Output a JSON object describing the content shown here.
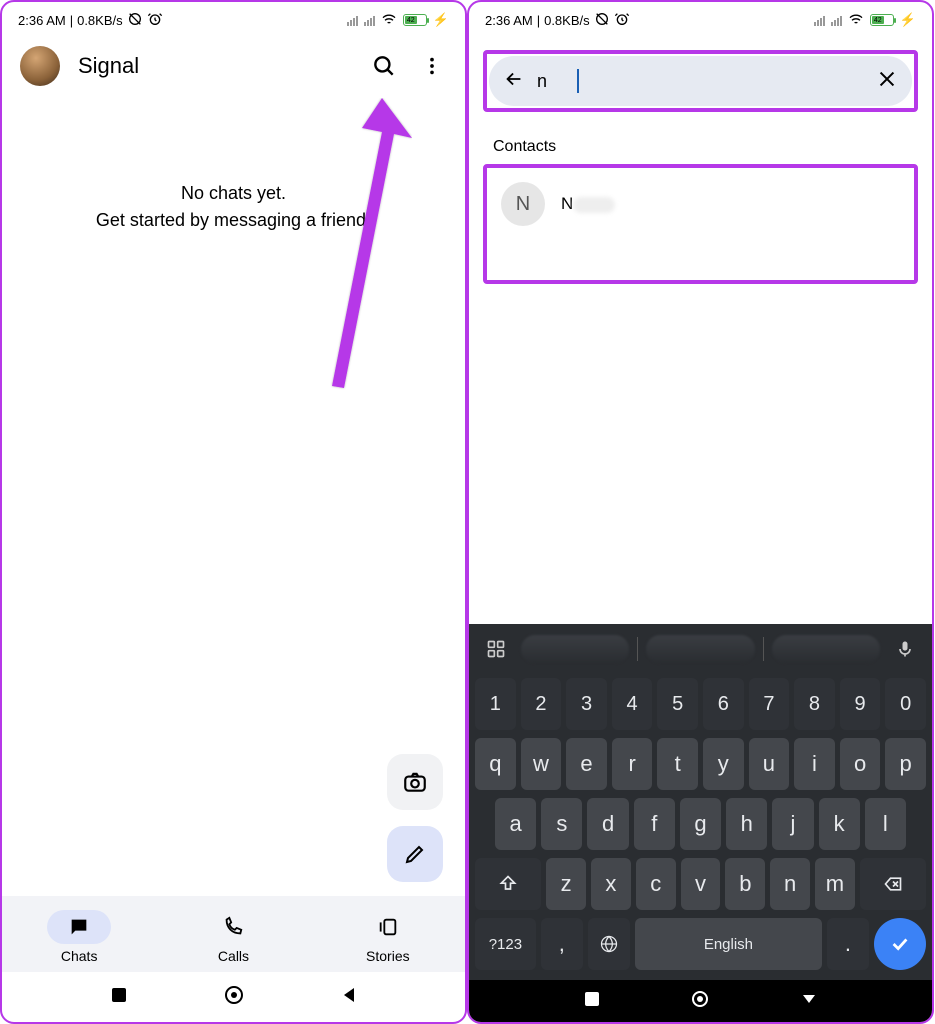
{
  "status": {
    "time": "2:36 AM",
    "speed": "0.8KB/s",
    "battery_text": "42"
  },
  "left": {
    "app_title": "Signal",
    "empty_line1": "No chats yet.",
    "empty_line2": "Get started by messaging a friend.",
    "nav": {
      "chats": "Chats",
      "calls": "Calls",
      "stories": "Stories"
    }
  },
  "right": {
    "search_value": "n",
    "section_label": "Contacts",
    "contact": {
      "initial": "N",
      "name": "N"
    },
    "keyboard": {
      "row_num": [
        "1",
        "2",
        "3",
        "4",
        "5",
        "6",
        "7",
        "8",
        "9",
        "0"
      ],
      "row1": [
        "q",
        "w",
        "e",
        "r",
        "t",
        "y",
        "u",
        "i",
        "o",
        "p"
      ],
      "row2": [
        "a",
        "s",
        "d",
        "f",
        "g",
        "h",
        "j",
        "k",
        "l"
      ],
      "row3": [
        "z",
        "x",
        "c",
        "v",
        "b",
        "n",
        "m"
      ],
      "symbols": "?123",
      "comma": ",",
      "lang": "English",
      "period": "."
    }
  }
}
